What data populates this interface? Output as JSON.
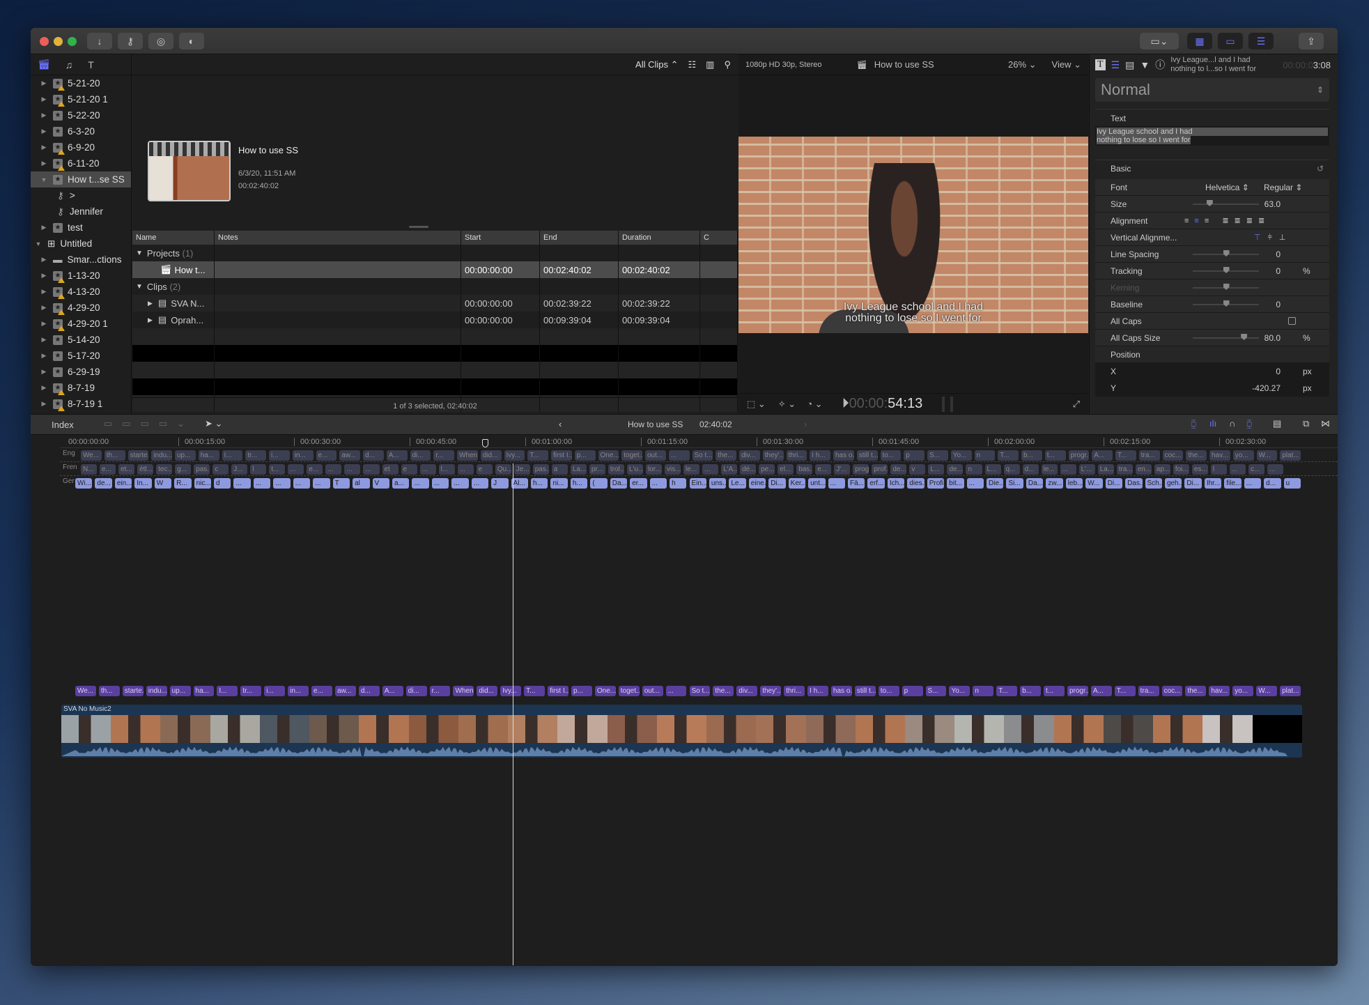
{
  "titlebar": {
    "buttons": [
      "import-icon",
      "keywords-icon",
      "background-tasks-icon",
      "voiceover-icon"
    ],
    "right_buttons": [
      "show-library-icon",
      "browser-layout-icon",
      "timeline-layout-icon",
      "inspector-icon",
      "share-icon"
    ]
  },
  "library": {
    "items": [
      {
        "label": "5-21-20",
        "warn": true,
        "expanded": false,
        "indent": 0
      },
      {
        "label": "5-21-20 1",
        "warn": true,
        "expanded": false,
        "indent": 0
      },
      {
        "label": "5-22-20",
        "warn": false,
        "expanded": false,
        "indent": 0
      },
      {
        "label": "6-3-20",
        "warn": false,
        "expanded": false,
        "indent": 0
      },
      {
        "label": "6-9-20",
        "warn": true,
        "expanded": false,
        "indent": 0
      },
      {
        "label": "6-11-20",
        "warn": true,
        "expanded": false,
        "indent": 0
      },
      {
        "label": "How t...se SS",
        "warn": false,
        "expanded": true,
        "selected": true,
        "indent": 0
      },
      {
        "label": ">",
        "type": "keyword",
        "indent": 1
      },
      {
        "label": "Jennifer",
        "type": "keyword",
        "indent": 1
      },
      {
        "label": "test",
        "warn": false,
        "expanded": false,
        "indent": 0
      },
      {
        "label": "Untitled",
        "type": "library",
        "expanded": true,
        "indent": -1
      },
      {
        "label": "Smar...ctions",
        "type": "folder",
        "indent": 0
      },
      {
        "label": "1-13-20",
        "warn": true,
        "indent": 0
      },
      {
        "label": "4-13-20",
        "warn": true,
        "indent": 0
      },
      {
        "label": "4-29-20",
        "warn": true,
        "indent": 0
      },
      {
        "label": "4-29-20 1",
        "warn": true,
        "indent": 0
      },
      {
        "label": "5-14-20",
        "warn": false,
        "indent": 0
      },
      {
        "label": "5-17-20",
        "warn": false,
        "indent": 0
      },
      {
        "label": "6-29-19",
        "warn": false,
        "indent": 0
      },
      {
        "label": "8-7-19",
        "warn": true,
        "indent": 0
      },
      {
        "label": "8-7-19 1",
        "warn": true,
        "indent": 0
      }
    ]
  },
  "browser": {
    "filter": "All Clips",
    "project": {
      "title": "How to use SS",
      "date": "6/3/20, 11:51 AM",
      "duration": "00:02:40:02"
    },
    "columns": [
      "Name",
      "Notes",
      "Start",
      "End",
      "Duration",
      "C"
    ],
    "groups": [
      {
        "label": "Projects",
        "count": "(1)",
        "rows": [
          {
            "name": "How t...",
            "start": "00:00:00:00",
            "end": "00:02:40:02",
            "duration": "00:02:40:02",
            "selected": true,
            "icon": "project-icon"
          }
        ]
      },
      {
        "label": "Clips",
        "count": "(2)",
        "rows": [
          {
            "name": "SVA N...",
            "start": "00:00:00:00",
            "end": "00:02:39:22",
            "duration": "00:02:39:22",
            "icon": "film-icon"
          },
          {
            "name": "Oprah...",
            "start": "00:00:00:00",
            "end": "00:09:39:04",
            "duration": "00:09:39:04",
            "icon": "film-icon"
          }
        ]
      }
    ],
    "status": "1 of 3 selected, 02:40:02"
  },
  "viewer": {
    "format": "1080p HD 30p, Stereo",
    "title": "How to use SS",
    "zoom": "26%",
    "view": "View",
    "caption_line1": "Ivy League school and I had",
    "caption_line2": "nothing to lose so I went for",
    "timecode_dim": "00:00:",
    "timecode": "54:13"
  },
  "inspector": {
    "header_text": "Ivy League...l and I had nothing to l...so I went for",
    "header_time_dim": "00:00:0",
    "header_time": "3:08",
    "role": "Normal",
    "text_label": "Text",
    "text_value_1": "Ivy League school and I had",
    "text_value_2": "nothing to lose so I went for",
    "section": "Basic",
    "font_label": "Font",
    "font_family": "Helvetica",
    "font_style": "Regular",
    "rows": [
      {
        "label": "Size",
        "value": "63.0",
        "unit": "",
        "slider": 0.25
      },
      {
        "label": "Alignment",
        "type": "align"
      },
      {
        "label": "Vertical Alignme...",
        "type": "valign"
      },
      {
        "label": "Line Spacing",
        "value": "0",
        "unit": "",
        "slider": 0.5
      },
      {
        "label": "Tracking",
        "value": "0",
        "unit": "%",
        "slider": 0.5
      },
      {
        "label": "Kerning",
        "value": "",
        "unit": "",
        "slider": 0.5,
        "disabled": true
      },
      {
        "label": "Baseline",
        "value": "0",
        "unit": "",
        "slider": 0.5
      },
      {
        "label": "All Caps",
        "type": "checkbox",
        "checked": false
      },
      {
        "label": "All Caps Size",
        "value": "80.0",
        "unit": "%",
        "slider": 0.77
      },
      {
        "label": "Position",
        "type": "header"
      },
      {
        "label": "X",
        "value": "0",
        "unit": "px",
        "dark": true
      },
      {
        "label": "Y",
        "value": "-420.27",
        "unit": "px",
        "dark": true
      }
    ]
  },
  "timeline_bar": {
    "index": "Index",
    "project": "How to use SS",
    "duration": "02:40:02"
  },
  "timeline": {
    "ruler": [
      "00:00:00:00",
      "00:00:15:00",
      "00:00:30:00",
      "00:00:45:00",
      "00:01:00:00",
      "00:01:15:00",
      "00:01:30:00",
      "00:01:45:00",
      "00:02:00:00",
      "00:02:15:00",
      "00:02:30:00"
    ],
    "lane_labels": [
      "Eng",
      "Fren",
      "Ger"
    ],
    "eng": [
      "We...",
      "th...",
      "starte...",
      "indu...",
      "up...",
      "ha...",
      "I...",
      "tr...",
      "i...",
      "in...",
      "e...",
      "aw...",
      "d...",
      "A...",
      "di...",
      "r...",
      "When...",
      "did...",
      "Ivy...",
      "T...",
      "first I...",
      "p...",
      "One...",
      "toget...",
      "out...",
      "...",
      "So t...",
      "the...",
      "div...",
      "they'...",
      "thri...",
      "I h...",
      "has o...",
      "still t...",
      "to...",
      "p",
      "S...",
      "Yo...",
      "n",
      "T...",
      "b...",
      "t...",
      "progr...",
      "A...",
      "T...",
      "tra...",
      "coc...",
      "the...",
      "hav...",
      "yo...",
      "W...",
      "plat..."
    ],
    "fre": [
      "N...",
      "e...",
      "et...",
      "étl...",
      "tec...",
      "g...",
      "pas...",
      "c",
      "J...",
      "l",
      "t...",
      "...",
      "e...",
      "...",
      "...",
      "...",
      "et",
      "e",
      "...",
      "l...",
      "...",
      "e",
      "Qu...",
      "Je...",
      "pas...",
      "a",
      "La...",
      "pr...",
      "trol...",
      "L'u...",
      "lor...",
      "vis...",
      "le...",
      "...",
      "L'A...",
      "dé...",
      "pe...",
      "el...",
      "bas...",
      "e...",
      "J'...",
      "prog...",
      "prof...",
      "de...",
      "v",
      "L...",
      "de...",
      "n",
      "L...",
      "q...",
      "d...",
      "le...",
      "...",
      "L'...",
      "La...",
      "tra...",
      "en...",
      "ap...",
      "foi...",
      "es...",
      "l",
      "...",
      "c...",
      "..."
    ],
    "ger": [
      "Wi...",
      "de...",
      "ein...",
      "In...",
      "W",
      "R...",
      "nic...",
      "d",
      "...",
      "...",
      "...",
      "...",
      "...",
      "T",
      "al",
      "V",
      "a...",
      "...",
      "...",
      "...",
      "...",
      "J",
      "Al...",
      "h...",
      "ni...",
      "h...",
      "(",
      "Da...",
      "er...",
      "...",
      "h",
      "Ein...",
      "uns...",
      "Le...",
      "eine...",
      "Di...",
      "Ker...",
      "unt...",
      "...",
      "Fä...",
      "erf...",
      "Ich...",
      "dies...",
      "Profi...",
      "bit...",
      "...",
      "Die...",
      "Si...",
      "Da...",
      "zw...",
      "leb...",
      "W...",
      "Di...",
      "Das...",
      "Sch...",
      "geh...",
      "Di...",
      "Ihr...",
      "file...",
      "...",
      "d...",
      "u"
    ],
    "connected": [
      "We...",
      "th...",
      "starte...",
      "indu...",
      "up...",
      "ha...",
      "I...",
      "tr...",
      "i...",
      "in...",
      "e...",
      "aw...",
      "d...",
      "A...",
      "di...",
      "r...",
      "When...",
      "did...",
      "Ivy...",
      "T...",
      "first I...",
      "p...",
      "One...",
      "toget...",
      "out...",
      "...",
      "So t...",
      "the...",
      "div...",
      "they'...",
      "thri...",
      "I h...",
      "has o...",
      "still t...",
      "to...",
      "p",
      "S...",
      "Yo...",
      "n",
      "T...",
      "b...",
      "t...",
      "progr...",
      "A...",
      "T...",
      "tra...",
      "coc...",
      "the...",
      "hav...",
      "yo...",
      "W...",
      "plat..."
    ],
    "clip_name": "SVA No Music2",
    "playhead_fraction": 0.304
  }
}
